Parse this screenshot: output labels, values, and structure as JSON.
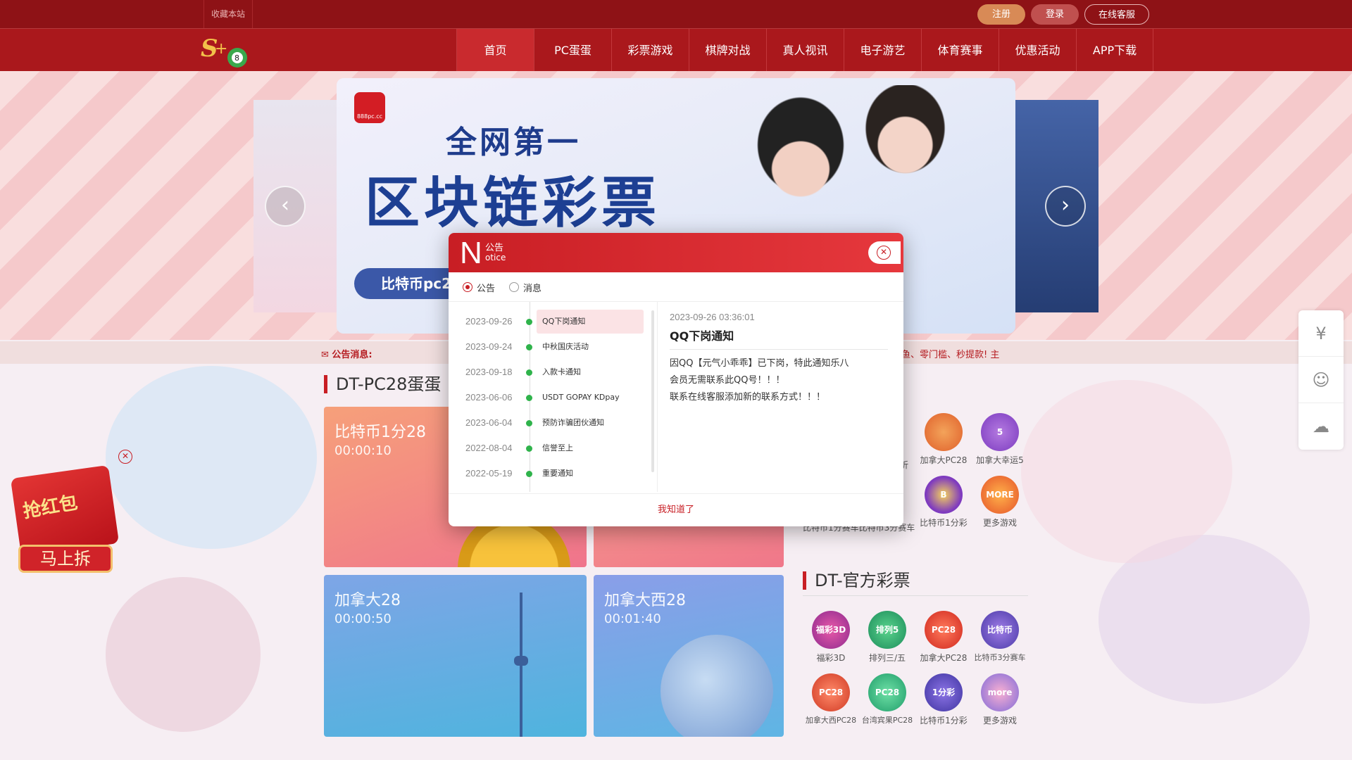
{
  "topbar": {
    "favorite": "收藏本站",
    "register": "注册",
    "login": "登录",
    "service": "在线客服"
  },
  "nav": {
    "items": [
      "首页",
      "PC蛋蛋",
      "彩票游戏",
      "棋牌对战",
      "真人视讯",
      "电子游艺",
      "体育赛事",
      "优惠活动",
      "APP下载"
    ],
    "active": "首页"
  },
  "banner": {
    "logo_text": "888pc.cc",
    "line1": "全网第一",
    "line2": "区块链彩票",
    "pill": "比特币pc28"
  },
  "notice_strip": {
    "label": "公告消息:",
    "scroll_text": "鱼、零门槛、秒提款! 主"
  },
  "sections": {
    "pc28": {
      "title": "DT-PC28蛋蛋",
      "cards": [
        {
          "name": "比特币1分28",
          "time": "00:00:10"
        },
        {
          "name": "",
          "time": ""
        },
        {
          "name": "加拿大28",
          "time": "00:00:50"
        },
        {
          "name": "加拿大西28",
          "time": "00:01:40"
        }
      ]
    },
    "hot": {
      "title_tail": "票",
      "games_row1": [
        "",
        "加拿大PC28",
        "加拿大幸运5"
      ],
      "games_row2": [
        "比特币1分赛车",
        "比特币3分赛车",
        "比特币1分彩",
        "更多游戏"
      ],
      "label_partial": "折"
    },
    "official": {
      "title": "DT-官方彩票",
      "games": [
        "福彩3D",
        "排列三/五",
        "加拿大PC28",
        "比特币3分赛车",
        "加拿大西PC28",
        "台湾宾果PC28",
        "比特币1分彩",
        "更多游戏"
      ],
      "icon_texts": [
        "福彩3D",
        "排列5",
        "PC28",
        "比特币",
        "PC28",
        "PC28",
        "1分彩",
        "more"
      ]
    }
  },
  "red_packet": {
    "title": "抢红包",
    "button": "马上拆"
  },
  "modal": {
    "head_letter": "N",
    "head_cn": "公告",
    "head_en": "otice",
    "tabs": [
      "公告",
      "消息"
    ],
    "active_tab": "公告",
    "list": [
      {
        "date": "2023-09-26",
        "title": "QQ下岗通知"
      },
      {
        "date": "2023-09-24",
        "title": "中秋国庆活动"
      },
      {
        "date": "2023-09-18",
        "title": "入款卡通知"
      },
      {
        "date": "2023-06-06",
        "title": "USDT GOPAY KDpay"
      },
      {
        "date": "2023-06-04",
        "title": "预防诈骗团伙通知"
      },
      {
        "date": "2022-08-04",
        "title": "信誉至上"
      },
      {
        "date": "2022-05-19",
        "title": "重要通知"
      }
    ],
    "selected_index": 0,
    "detail": {
      "time": "2023-09-26 03:36:01",
      "title": "QQ下岗通知",
      "lines": [
        "因QQ【元气小乖乖】已下岗，特此通知乐八",
        "会员无需联系此QQ号！！！",
        "联系在线客服添加新的联系方式！！！"
      ]
    },
    "confirm": "我知道了"
  },
  "colors": {
    "brand_red": "#c81e24",
    "top_bar": "#8e1216",
    "nav_bar": "#aa181c",
    "list_dot": "#2fb34b"
  },
  "icons": {
    "sidebar": [
      "money-bag-icon",
      "customer-service-icon",
      "cloud-download-icon"
    ]
  }
}
